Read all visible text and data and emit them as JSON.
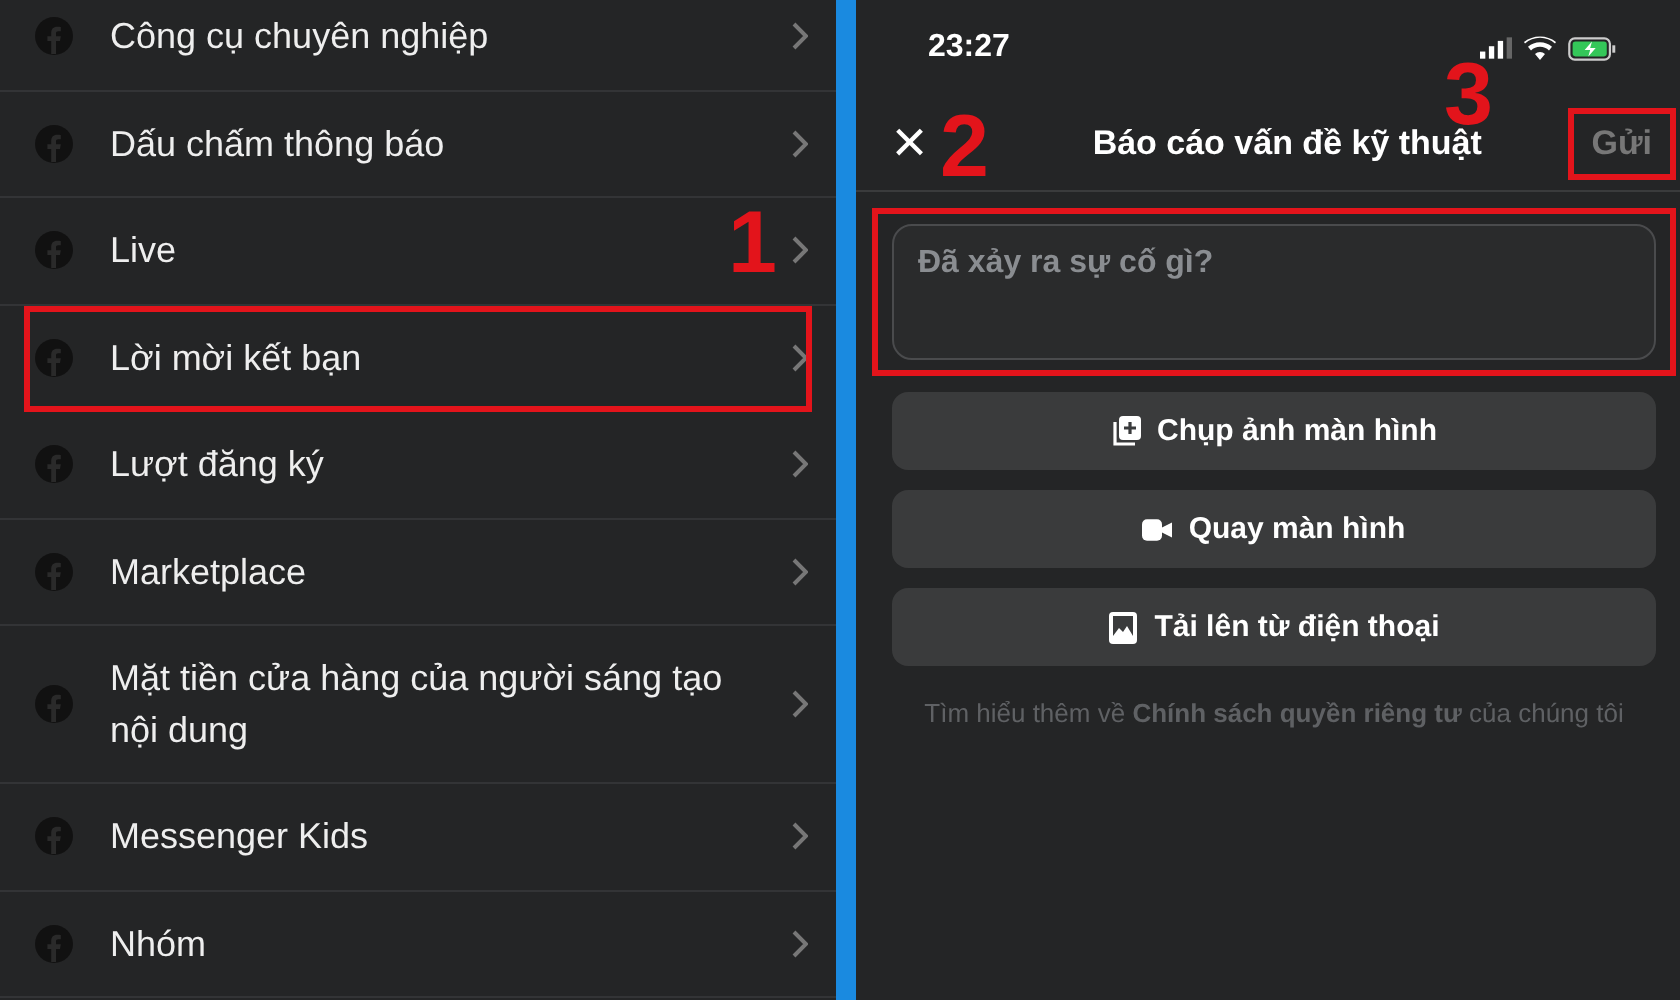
{
  "menu": {
    "items": [
      {
        "label": "Công cụ chuyên nghiệp",
        "highlighted": false
      },
      {
        "label": "Dấu chấm thông báo",
        "highlighted": false
      },
      {
        "label": "Live",
        "highlighted": false
      },
      {
        "label": "Lời mời kết bạn",
        "highlighted": true
      },
      {
        "label": "Lượt đăng ký",
        "highlighted": false
      },
      {
        "label": "Marketplace",
        "highlighted": false
      },
      {
        "label": "Mặt tiền cửa hàng của người sáng tạo nội dung",
        "highlighted": false
      },
      {
        "label": "Messenger Kids",
        "highlighted": false
      },
      {
        "label": "Nhóm",
        "highlighted": false
      }
    ]
  },
  "status_bar": {
    "time": "23:27"
  },
  "report": {
    "close": "×",
    "title": "Báo cáo vấn đề kỹ thuật",
    "send": {
      "label": "Gửi",
      "disabled": true,
      "highlighted": true
    },
    "field": {
      "placeholder": "Đã xảy ra sự cố gì?",
      "highlighted": true
    },
    "actions": [
      {
        "kind": "screenshot",
        "label": "Chụp ảnh màn hình"
      },
      {
        "kind": "record",
        "label": "Quay màn hình"
      },
      {
        "kind": "upload",
        "label": "Tải lên từ điện thoại"
      }
    ],
    "footer": "Tìm hiểu thêm về **Chính sách quyền riêng tư** của chúng tôi"
  },
  "step_markers": [
    "1",
    "2",
    "3"
  ]
}
